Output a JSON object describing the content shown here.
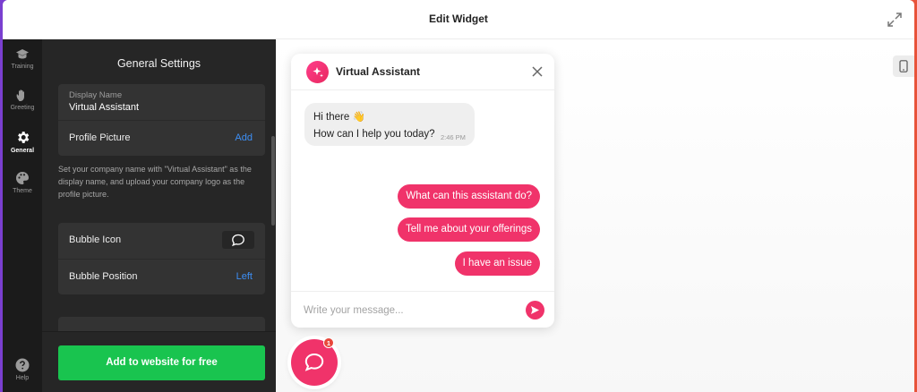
{
  "window": {
    "title": "Edit Widget"
  },
  "rail": {
    "items": [
      {
        "label": "Training",
        "icon": "graduation-cap-icon"
      },
      {
        "label": "Greeting",
        "icon": "waving-hand-icon"
      },
      {
        "label": "General",
        "icon": "gear-icon",
        "active": true
      },
      {
        "label": "Theme",
        "icon": "palette-icon"
      }
    ],
    "help_label": "Help"
  },
  "panel": {
    "title": "General Settings",
    "display_name_label": "Display Name",
    "display_name_value": "Virtual Assistant",
    "profile_picture_label": "Profile Picture",
    "profile_picture_action": "Add",
    "help_text": "Set your company name with \"Virtual Assistant\" as the display name, and upload your company logo as the profile picture.",
    "bubble_icon_label": "Bubble Icon",
    "bubble_position_label": "Bubble Position",
    "bubble_position_value": "Left",
    "cta_label": "Add to website for free"
  },
  "chat": {
    "title": "Virtual Assistant",
    "greeting_line1": "Hi there 👋",
    "greeting_line2": "How can I help you today?",
    "greeting_time": "2:46 PM",
    "suggestions": [
      "What can this assistant do?",
      "Tell me about your offerings",
      "I have an issue"
    ],
    "input_placeholder": "Write your message...",
    "launcher_badge": "1"
  },
  "colors": {
    "accent": "#f0336a",
    "cta": "#19c44f",
    "link": "#3d8ff5",
    "panel_bg": "#262626"
  }
}
